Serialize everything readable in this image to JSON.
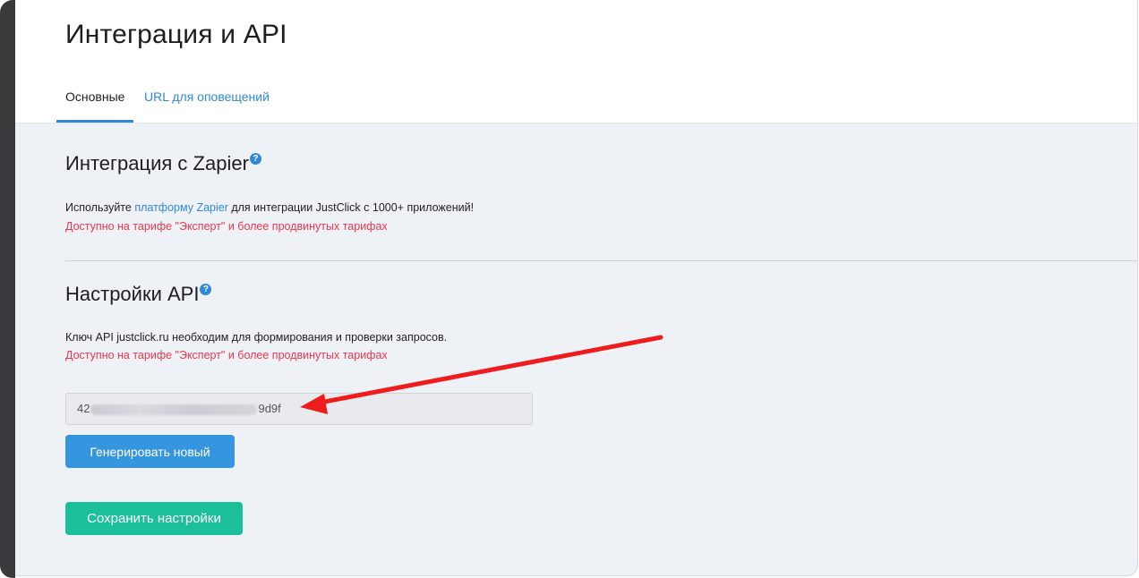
{
  "header": {
    "title": "Интеграция и API",
    "tabs": [
      {
        "label": "Основные",
        "active": true
      },
      {
        "label": "URL для оповещений",
        "active": false
      }
    ]
  },
  "zapier": {
    "title": "Интеграция с Zapier",
    "help": "?",
    "text_before": "Используйте ",
    "link_text": "платформу Zapier",
    "text_after": " для интеграции JustClick с 1000+ приложений!",
    "warning": "Доступно на тарифе \"Эксперт\" и более продвинутых тарифах"
  },
  "api": {
    "title": "Настройки API",
    "help": "?",
    "description": "Ключ API justclick.ru необходим для формирования и проверки запросов.",
    "warning": "Доступно на тарифе \"Эксперт\" и более продвинутых тарифах",
    "key_prefix": "42",
    "key_suffix": "9d9f",
    "generate_button": "Генерировать новый"
  },
  "save_button": "Сохранить настройки",
  "colors": {
    "accent": "#2e8ad8",
    "warning": "#e8384f",
    "save": "#1bbf9a",
    "annotation_arrow": "#ee1c1c"
  }
}
